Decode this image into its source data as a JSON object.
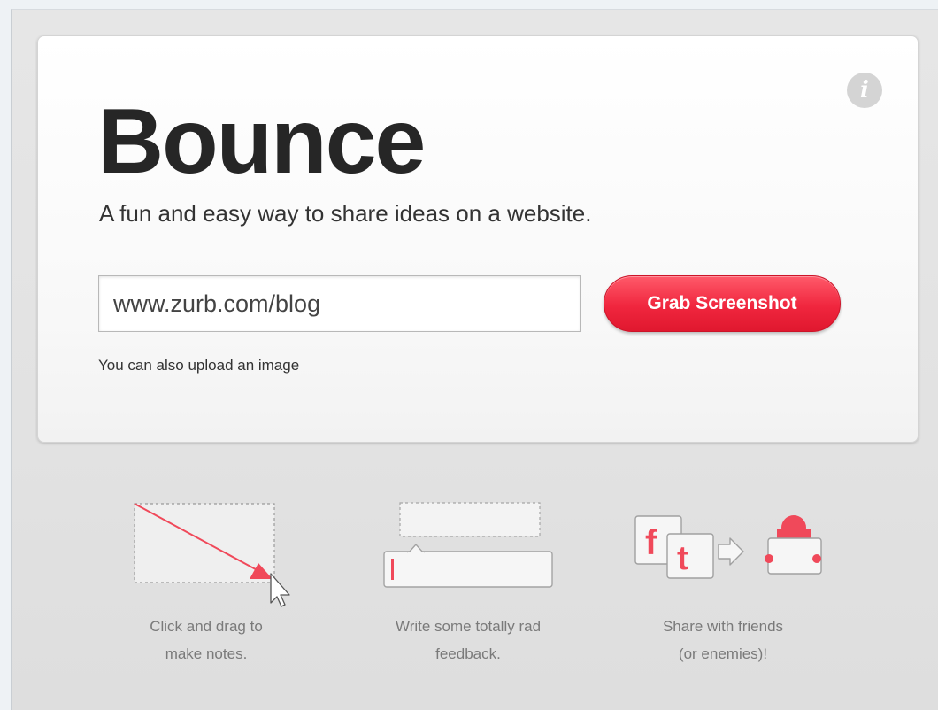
{
  "hero": {
    "title": "Bounce",
    "tagline": "A fun and easy way to share ideas on a website.",
    "url_input_value": "www.zurb.com/blog",
    "grab_button_label": "Grab Screenshot",
    "upload_prefix": "You can also",
    "upload_link_label": "upload an image"
  },
  "features": [
    {
      "icon": "drag-note-icon",
      "line1": "Click and drag to",
      "line2": "make notes."
    },
    {
      "icon": "feedback-text-icon",
      "line1": "Write some totally rad",
      "line2": "feedback."
    },
    {
      "icon": "share-friends-icon",
      "line1": "Share with friends",
      "line2": "(or enemies)!"
    }
  ],
  "info_glyph": "i",
  "share_glyphs": {
    "facebook": "f",
    "twitter": "t"
  },
  "colors": {
    "accent": "#f0263e",
    "title": "#262626",
    "caption": "#7a7a7a"
  }
}
